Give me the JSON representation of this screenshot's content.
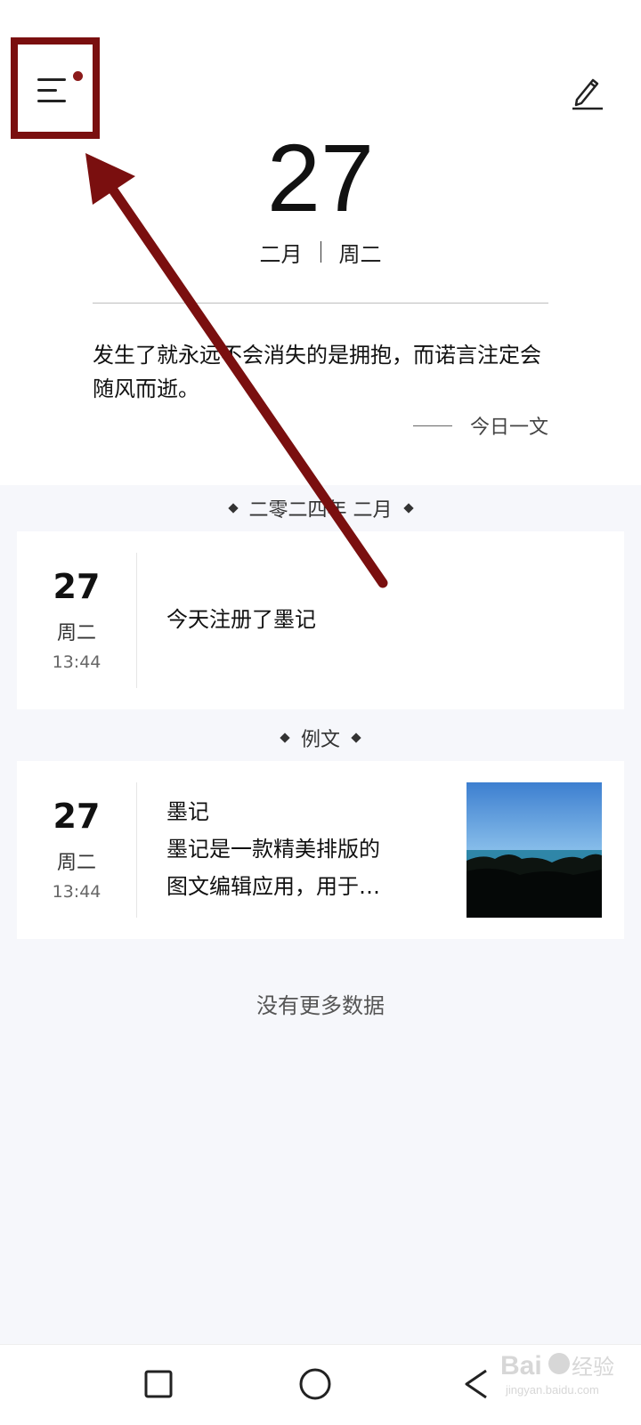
{
  "header": {
    "day": "27",
    "month": "二月",
    "weekday": "周二",
    "quote": "发生了就永远不会消失的是拥抱，而诺言注定会随风而逝。",
    "quote_source": "今日一文"
  },
  "sections": [
    {
      "label": "二零二四年 二月",
      "entry": {
        "day": "27",
        "weekday": "周二",
        "time": "13:44",
        "text": "今天注册了墨记"
      }
    },
    {
      "label": "例文",
      "entry": {
        "day": "27",
        "weekday": "周二",
        "time": "13:44",
        "title": "墨记",
        "excerpt_line1": "墨记是一款精美排版的",
        "excerpt_line2": "图文编辑应用，用于…"
      }
    }
  ],
  "footer_text": "没有更多数据",
  "icons": {
    "menu": "menu-icon",
    "notification_dot": "notification-dot-icon",
    "edit": "pencil-icon",
    "nav_recent": "square-icon",
    "nav_home": "circle-icon",
    "nav_back": "triangle-back-icon"
  },
  "colors": {
    "annotation": "#7a0f0f",
    "notification_dot": "#8b1a1a",
    "list_background": "#f6f7fb"
  },
  "watermark": {
    "brand": "Baidu",
    "brand_cn": "经验",
    "url": "jingyan.baidu.com"
  }
}
